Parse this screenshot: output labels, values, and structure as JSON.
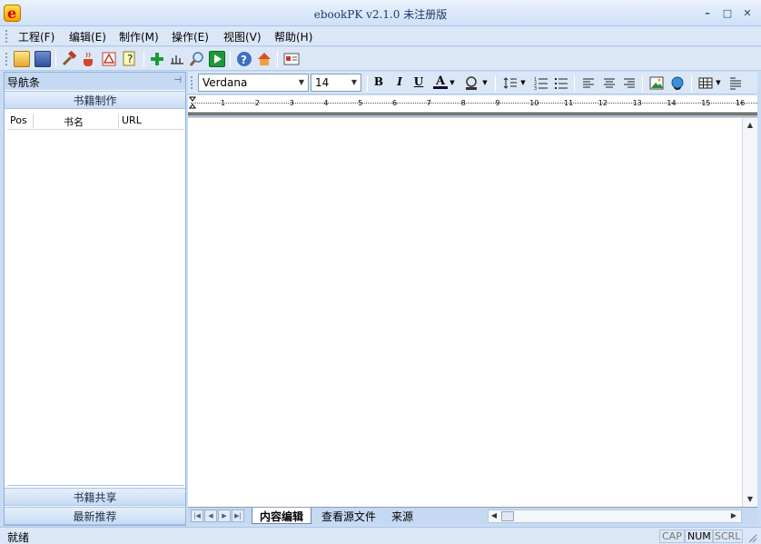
{
  "window": {
    "title": "ebookPK v2.1.0  未注册版",
    "minimize_label": "–",
    "maximize_label": "□",
    "close_label": "✕"
  },
  "menu": {
    "items": [
      {
        "label": "工程(F)"
      },
      {
        "label": "编辑(E)"
      },
      {
        "label": "制作(M)"
      },
      {
        "label": "操作(E)"
      },
      {
        "label": "视图(V)"
      },
      {
        "label": "帮助(H)"
      }
    ]
  },
  "toolbar": {
    "icons": [
      "open-folder-icon",
      "save-icon",
      "hammer-icon",
      "java-cup-icon",
      "pdf-icon",
      "help-document-icon",
      "add-icon",
      "ruler-icon",
      "search-icon",
      "run-icon",
      "help-icon",
      "home-icon",
      "card-icon"
    ]
  },
  "navigation": {
    "title": "导航条",
    "pin_glyph": "⊣",
    "section_top": "书籍制作",
    "columns": [
      "Pos",
      "书名",
      "URL"
    ],
    "section_share": "书籍共享",
    "section_recommend": "最新推荐"
  },
  "format_toolbar": {
    "font_family": "Verdana",
    "font_size": "14",
    "bold": "B",
    "italic": "I",
    "underline": "U",
    "font_color_glyph": "A"
  },
  "ruler": {
    "numbers": [
      "1",
      "2",
      "3",
      "4",
      "5",
      "6",
      "7",
      "8",
      "9",
      "10",
      "11",
      "12",
      "13",
      "14",
      "15",
      "16"
    ]
  },
  "tabs": {
    "items": [
      {
        "label": "内容编辑"
      },
      {
        "label": "查看源文件"
      },
      {
        "label": "来源"
      }
    ]
  },
  "status": {
    "text": "就绪",
    "cap": "CAP",
    "num": "NUM",
    "scrl": "SCRL"
  },
  "colors": {
    "background": "#c9dcf4",
    "accent": "#8fb0dc"
  }
}
